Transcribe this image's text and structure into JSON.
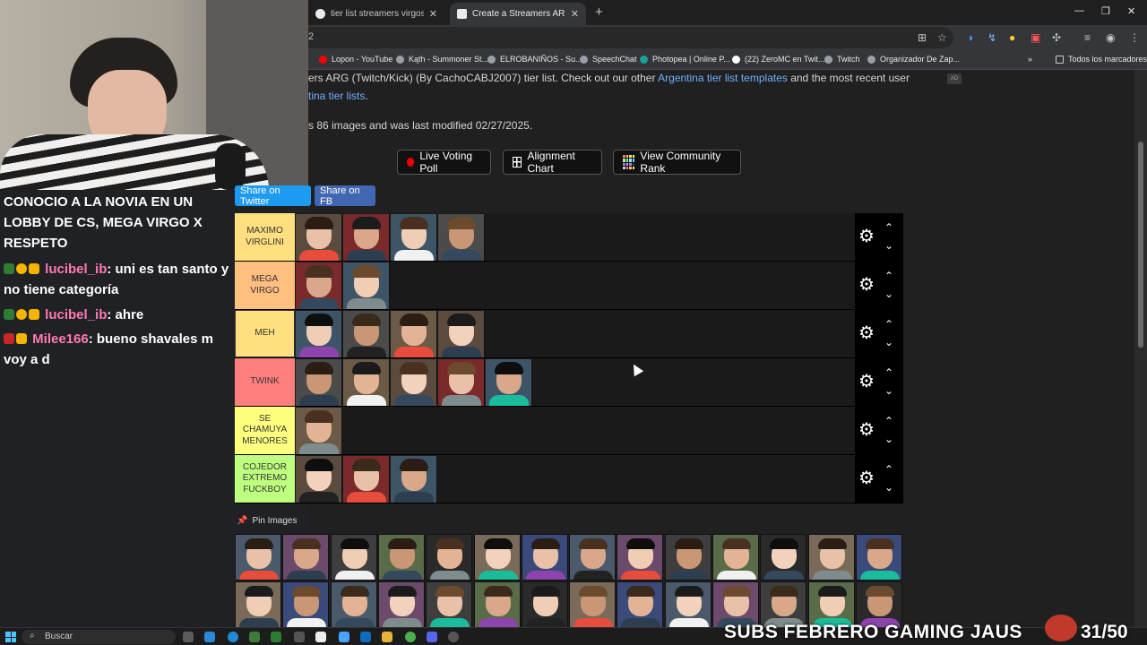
{
  "browser": {
    "tabs": [
      {
        "title": "tier list streamers virgos - Busc",
        "active": false
      },
      {
        "title": "Create a Streamers ARG (Twitch",
        "active": true
      }
    ],
    "new_tab": "+",
    "window_controls": [
      "—",
      "❐",
      "✕"
    ],
    "omnibox_text": "2",
    "bookmarks": [
      {
        "label": "Lopon - YouTube",
        "color": "#ff0000"
      },
      {
        "label": "Kąth - Summoner St...",
        "color": "#9aa0a6"
      },
      {
        "label": "ELROBANIÑOS - Su...",
        "color": "#9aa0a6"
      },
      {
        "label": "SpeechChat",
        "color": "#9aa0a6"
      },
      {
        "label": "Photopea | Online P...",
        "color": "#18a497"
      },
      {
        "label": "(22) ZeroMC en Twit...",
        "color": "#ffffff"
      },
      {
        "label": "Twitch",
        "color": "#9aa0a6"
      },
      {
        "label": "Organizador De Zap...",
        "color": "#9aa0a6"
      }
    ],
    "bookmarks_overflow": "»",
    "all_bookmarks": "Todos los marcadores"
  },
  "page": {
    "intro_line1_pre": "ers ARG (Twitch/Kick) (By CachoCABJ2007) tier list. Check out our other ",
    "intro_link1": "Argentina tier list templates",
    "intro_line1_post": " and the most recent user",
    "intro_line2_link": "tina tier lists",
    "intro_line2_post": ".",
    "meta_line": "s 86 images and was last modified 02/27/2025.",
    "ad_badge": "AD",
    "buttons": {
      "live_voting": "Live Voting Poll",
      "alignment": "Alignment Chart",
      "community_rank": "View Community Rank"
    },
    "share_twitter": "Share on Twitter",
    "share_fb": "Share on FB",
    "tiers": [
      {
        "label": "MAXIMO VIRGLINI",
        "color": "#ffdf7f",
        "count": 4,
        "editing": false
      },
      {
        "label": "MEGA VIRGO",
        "color": "#ffbf7f",
        "count": 2,
        "editing": false
      },
      {
        "label": "MEH",
        "color": "#ffdf7f",
        "count": 4,
        "editing": true
      },
      {
        "label": "TWINK",
        "color": "#ff7f7f",
        "count": 5,
        "editing": false
      },
      {
        "label": "SE CHAMUYA MENORES",
        "color": "#ffff7f",
        "count": 1,
        "editing": false
      },
      {
        "label": "COJEDOR EXTREMO FUCKBOY",
        "color": "#bfff7f",
        "count": 3,
        "editing": false
      }
    ],
    "tier_controls": {
      "gear": "⚙",
      "up": "⌃",
      "down": "⌄"
    },
    "pin_images": "Pin Images"
  },
  "webcam": {
    "description_free": true
  },
  "chat": {
    "title_message": "CONOCIO A LA NOVIA EN UN LOBBY DE CS, MEGA VIRGO X RESPETO",
    "messages": [
      {
        "user": "lucibel_ib",
        "text": ": uni es tan santo y no tiene categoría"
      },
      {
        "user": "lucibel_ib",
        "text": ": ahre"
      },
      {
        "user": "Milee166",
        "text": ": bueno shavales m voy a d"
      }
    ]
  },
  "taskbar": {
    "search_placeholder": "Buscar",
    "overlay_text": "SUBS FEBRERO GAMING JAUS",
    "overlay_count": "31/50"
  }
}
